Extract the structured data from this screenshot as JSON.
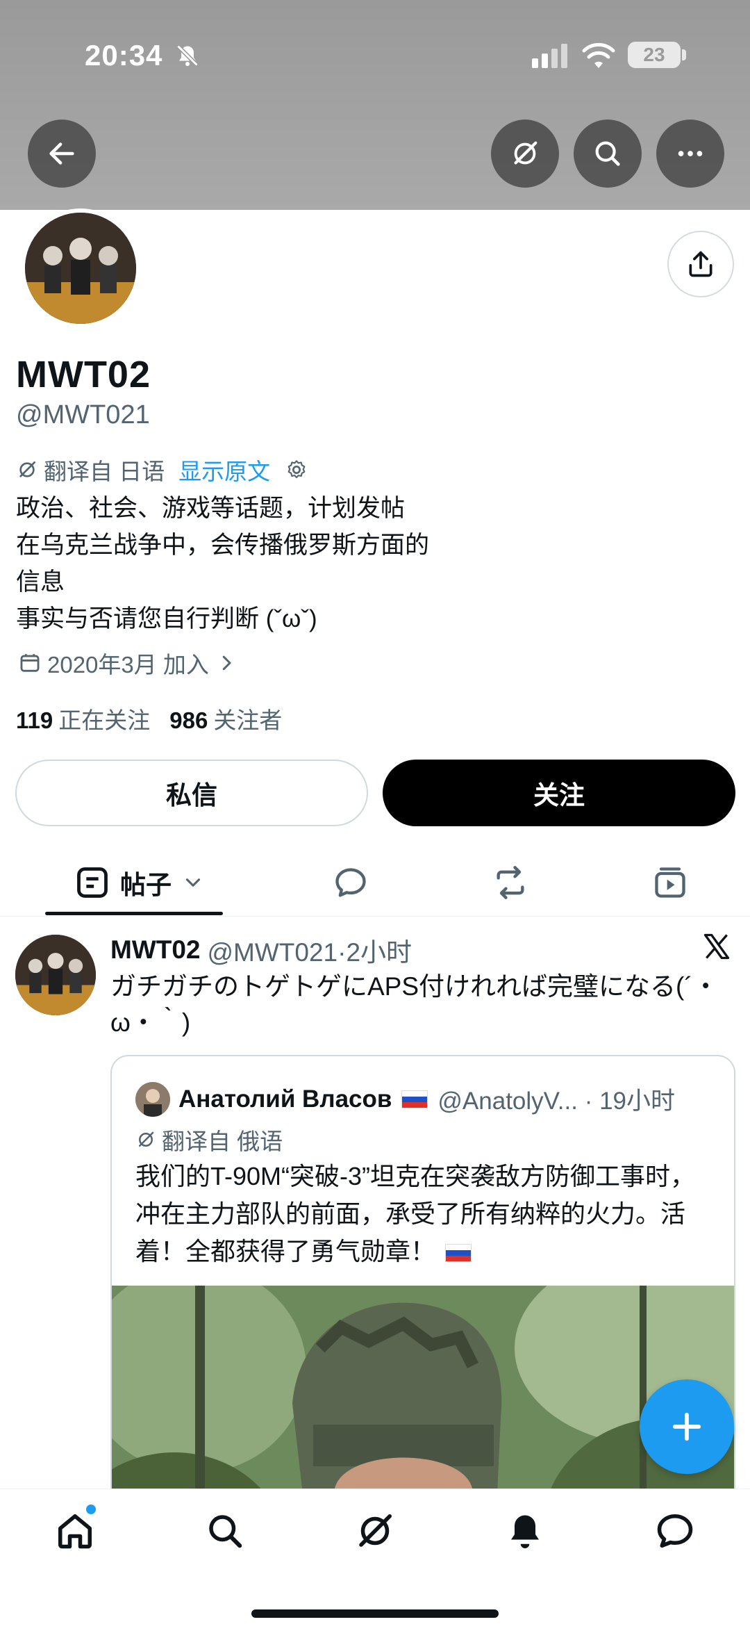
{
  "status_bar": {
    "time": "20:34",
    "battery": "23"
  },
  "profile": {
    "display_name": "MWT02",
    "handle": "@MWT021",
    "translated_from": "翻译自 日语",
    "show_original": "显示原文",
    "bio_lines": [
      "政治、社会、游戏等话题，计划发帖",
      "在乌克兰战争中，会传播俄罗斯方面的",
      "信息",
      "事实与否请您自行判断 (ˇωˇ)"
    ],
    "joined": "2020年3月 加入",
    "following_count": "119",
    "following_label": "正在关注",
    "followers_count": "986",
    "followers_label": "关注者"
  },
  "actions": {
    "message_label": "私信",
    "follow_label": "关注"
  },
  "tabs": {
    "posts_label": "帖子"
  },
  "post": {
    "name": "MWT02",
    "meta": "@MWT021·2小时",
    "text": "ガチガチのトゲトゲにAPS付けれれば完璧になる(´・ω・｀)",
    "quote": {
      "name": "Анатолий Власов",
      "meta": "@AnatolyV... · 19小时",
      "translated_from": "翻译自 俄语",
      "text": "我们的T-90M“突破-3”坦克在突袭敌方防御工事时，冲在主力部队的前面，承受了所有纳粹的火力。活着！全都获得了勇气勋章！"
    }
  },
  "colors": {
    "accent": "#1d9bf0",
    "text": "#0f1419",
    "secondary": "#536471"
  }
}
